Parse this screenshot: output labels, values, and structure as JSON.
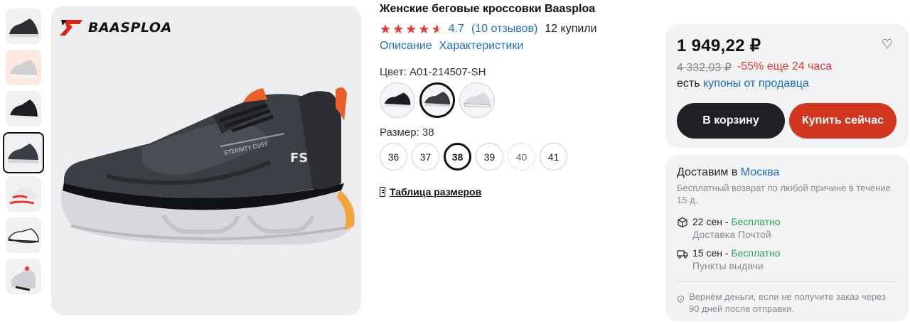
{
  "product": {
    "title": "Женские беговые кроссовки Baasploa",
    "rating": "4.7",
    "reviews": "(10 отзывов)",
    "bought": "12 купили",
    "tabs": [
      "Описание",
      "Характеристики"
    ],
    "brand_logo_text": "BAASPLOA",
    "color_label": "Цвет: A01-214507-SH",
    "size_label": "Размер: 38",
    "sizes": [
      "36",
      "37",
      "38",
      "39",
      "40",
      "41"
    ],
    "selected_size": "38",
    "size_table": "Таблица размеров"
  },
  "pricing": {
    "price": "1 949,22 ₽",
    "old_price": "4 332,03 ₽",
    "discount": "-55% еще 24 часа",
    "coupons_prefix": "есть",
    "coupons_link": "купоны от продавца",
    "cart_button": "В корзину",
    "buy_button": "Купить сейчас"
  },
  "delivery": {
    "deliver_prefix": "Доставим в",
    "city": "Москва",
    "return_text": "Бесплатный возврат по любой причине в течение 15 д.",
    "options": [
      {
        "date": "22 сен -",
        "price": "Бесплатно",
        "method": "Доставка Почтой",
        "icon": "box-icon"
      },
      {
        "date": "15 сен -",
        "price": "Бесплатно",
        "method": "Пункты выдачи",
        "icon": "truck-icon"
      }
    ],
    "guarantee": "Вернём деньги, если не получите заказ через 90 дней после отправки."
  },
  "colors": {
    "accent_red": "#e8372b",
    "link_blue": "#1d6fc9",
    "free_green": "#2aa54b",
    "buy_button": "#d2361f",
    "cart_button": "#1f2023"
  }
}
